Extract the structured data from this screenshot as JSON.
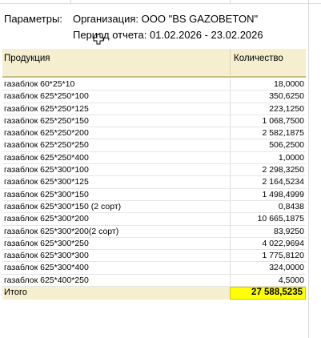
{
  "params": {
    "label": "Параметры:",
    "organization": "Организация: ООО \"BS GAZOBETON\"",
    "period": "Период отчета: 01.02.2026 - 23.02.2026"
  },
  "table": {
    "columns": [
      "Продукция",
      "Количество"
    ],
    "rows": [
      {
        "name": "газаблок 60*25*10",
        "qty": "18,0000"
      },
      {
        "name": "газаблок 625*250*100",
        "qty": "350,6250"
      },
      {
        "name": "газаблок 625*250*125",
        "qty": "223,1250"
      },
      {
        "name": "газаблок 625*250*150",
        "qty": "1 068,7500"
      },
      {
        "name": "газаблок 625*250*200",
        "qty": "2 582,1875"
      },
      {
        "name": "газаблок 625*250*250",
        "qty": "506,2500"
      },
      {
        "name": "газаблок 625*250*400",
        "qty": "1,0000"
      },
      {
        "name": "газаблок 625*300*100",
        "qty": "2 298,3250"
      },
      {
        "name": "газаблок 625*300*125",
        "qty": "2 164,5234"
      },
      {
        "name": "газаблок 625*300*150",
        "qty": "1 498,4999"
      },
      {
        "name": "газаблок 625*300*150 (2 сорт)",
        "qty": "0,8438"
      },
      {
        "name": "газаблок 625*300*200",
        "qty": "10 665,1875"
      },
      {
        "name": "газаблок 625*300*200(2 сорт)",
        "qty": "83,9250"
      },
      {
        "name": "газаблок 625*300*250",
        "qty": "4 022,9694"
      },
      {
        "name": "газаблок 625*300*300",
        "qty": "1 775,8120"
      },
      {
        "name": "газаблок 625*300*400",
        "qty": "324,0000"
      },
      {
        "name": "газаблок 625*400*250",
        "qty": "4,5000"
      }
    ],
    "total": {
      "label": "Итого",
      "qty": "27 588,5235"
    }
  },
  "colors": {
    "header_bg": "#f5efcf",
    "total_highlight": "#ffff00"
  },
  "icons": {
    "cursor": "move-cursor-icon"
  }
}
